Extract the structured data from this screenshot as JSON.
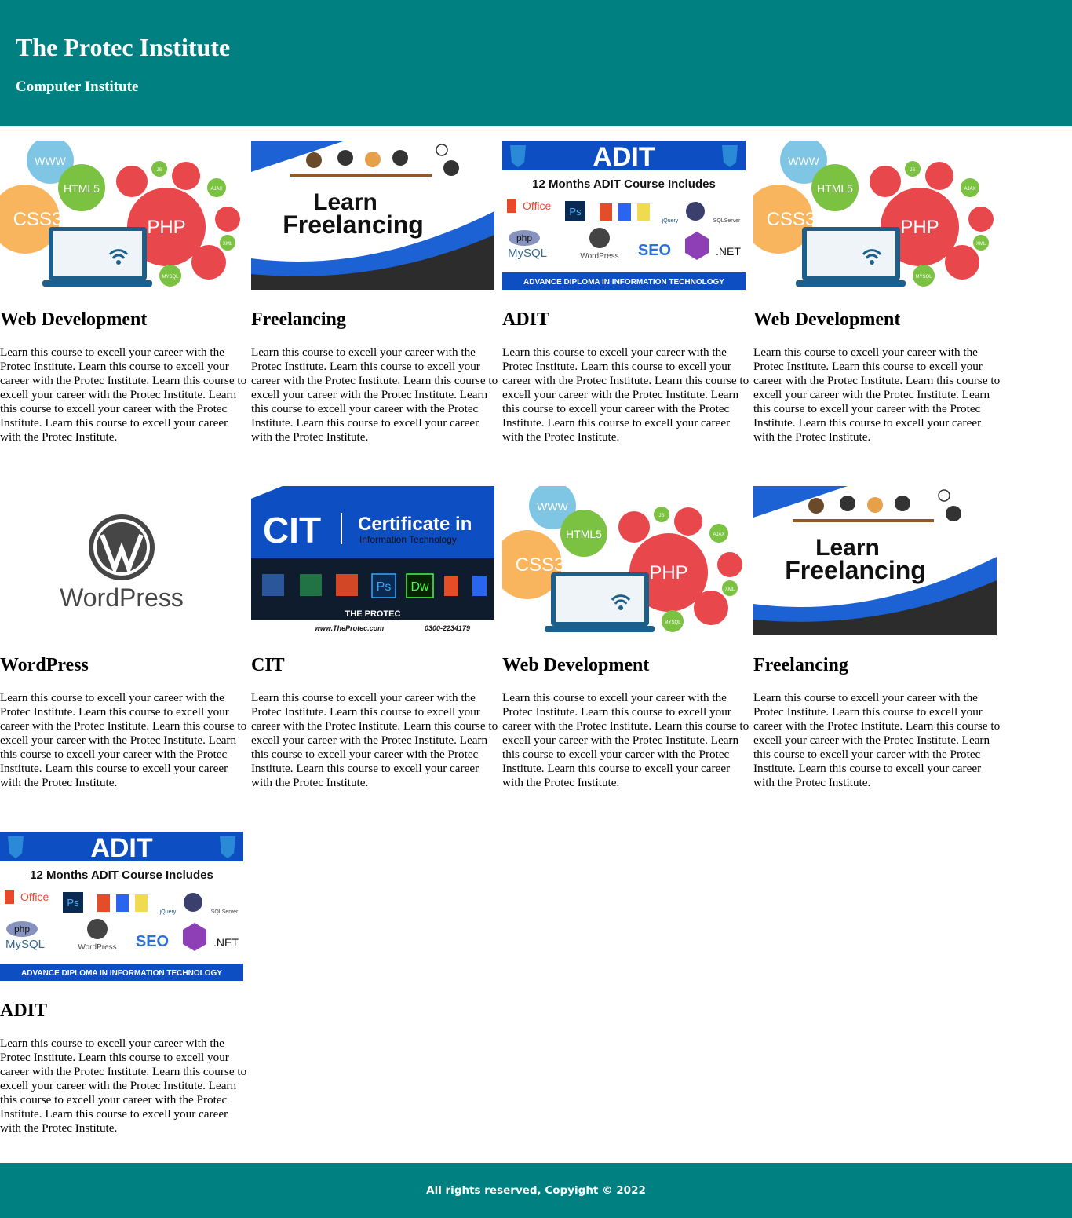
{
  "header": {
    "title": "The Protec Institute",
    "subtitle": "Computer Institute"
  },
  "courses": [
    {
      "title": "Web Development",
      "image": "web-development-illustration",
      "description": "Learn this course to excell your career with the Protec Institute. Learn this course to excell your career with the Protec Institute. Learn this course to excell your career with the Protec Institute. Learn this course to excell your career with the Protec Institute. Learn this course to excell your career with the Protec Institute."
    },
    {
      "title": "Freelancing",
      "image": "learn-freelancing-banner",
      "description": "Learn this course to excell your career with the Protec Institute. Learn this course to excell your career with the Protec Institute. Learn this course to excell your career with the Protec Institute. Learn this course to excell your career with the Protec Institute. Learn this course to excell your career with the Protec Institute."
    },
    {
      "title": "ADIT",
      "image": "adit-banner",
      "description": "Learn this course to excell your career with the Protec Institute. Learn this course to excell your career with the Protec Institute. Learn this course to excell your career with the Protec Institute. Learn this course to excell your career with the Protec Institute. Learn this course to excell your career with the Protec Institute."
    },
    {
      "title": "Web Development",
      "image": "web-development-illustration",
      "description": "Learn this course to excell your career with the Protec Institute. Learn this course to excell your career with the Protec Institute. Learn this course to excell your career with the Protec Institute. Learn this course to excell your career with the Protec Institute. Learn this course to excell your career with the Protec Institute."
    },
    {
      "title": "WordPress",
      "image": "wordpress-logo",
      "description": "Learn this course to excell your career with the Protec Institute. Learn this course to excell your career with the Protec Institute. Learn this course to excell your career with the Protec Institute. Learn this course to excell your career with the Protec Institute. Learn this course to excell your career with the Protec Institute."
    },
    {
      "title": "CIT",
      "image": "cit-banner",
      "description": "Learn this course to excell your career with the Protec Institute. Learn this course to excell your career with the Protec Institute. Learn this course to excell your career with the Protec Institute. Learn this course to excell your career with the Protec Institute. Learn this course to excell your career with the Protec Institute."
    },
    {
      "title": "Web Development",
      "image": "web-development-illustration",
      "description": "Learn this course to excell your career with the Protec Institute. Learn this course to excell your career with the Protec Institute. Learn this course to excell your career with the Protec Institute. Learn this course to excell your career with the Protec Institute. Learn this course to excell your career with the Protec Institute."
    },
    {
      "title": "Freelancing",
      "image": "learn-freelancing-banner",
      "description": "Learn this course to excell your career with the Protec Institute. Learn this course to excell your career with the Protec Institute. Learn this course to excell your career with the Protec Institute. Learn this course to excell your career with the Protec Institute. Learn this course to excell your career with the Protec Institute."
    },
    {
      "title": "ADIT",
      "image": "adit-banner",
      "description": "Learn this course to excell your career with the Protec Institute. Learn this course to excell your career with the Protec Institute. Learn this course to excell your career with the Protec Institute. Learn this course to excell your career with the Protec Institute. Learn this course to excell your career with the Protec Institute."
    }
  ],
  "image_text": {
    "web": [
      "WWW",
      "HTML5",
      "CSS3",
      "PHP",
      "JS",
      "AJAX",
      "XML",
      "MYSQL"
    ],
    "freelancing": [
      "Learn",
      "Freelancing"
    ],
    "adit": [
      "ADIT",
      "12 Months ADIT Course Includes",
      "Office",
      "Ps",
      "php",
      "MySQL",
      "WordPress",
      "SEO",
      ".NET",
      "SQLServer",
      "jQuery",
      "ADVANCE DIPLOMA IN INFORMATION TECHNOLOGY"
    ],
    "wordpress": [
      "WordPress"
    ],
    "cit": [
      "CIT",
      "Certificate in",
      "Information Technology",
      "Ps",
      "Dw",
      "THE PROTEC",
      "www.TheProtec.com",
      "0300-2234179"
    ]
  },
  "footer": {
    "text": "All rights reserved, Copyight © 2022"
  },
  "colors": {
    "header_bg": "#008080",
    "footer_bg": "#008080",
    "adit_blue": "#0d4fc2",
    "php_red": "#e8474c",
    "css_orange": "#f9b45e",
    "html_green": "#7cc242"
  }
}
